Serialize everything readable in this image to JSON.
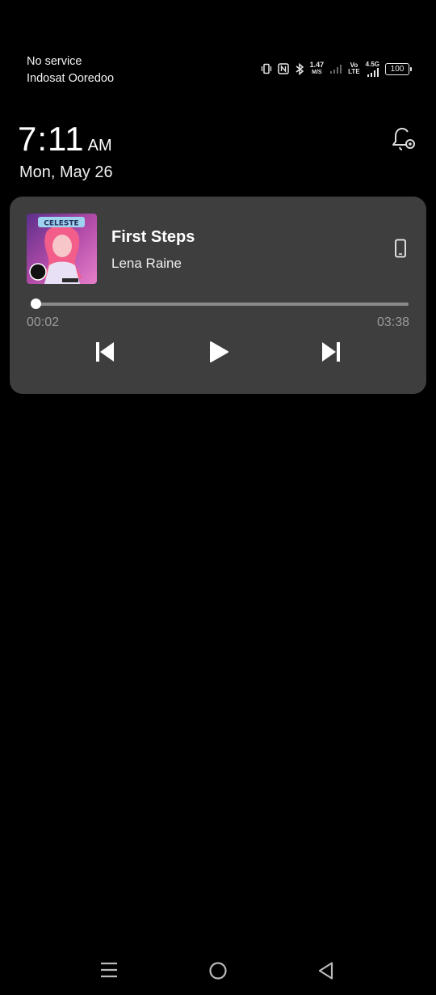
{
  "status_bar": {
    "line1": "No service",
    "line2": "Indosat Ooredoo",
    "speed_value": "1.47",
    "speed_unit": "M/S",
    "volte_top": "Vo",
    "volte_bottom": "LTE",
    "network_type": "4.5G",
    "battery_level": "100",
    "icons": [
      "vibrate-icon",
      "nfc-icon",
      "bluetooth-icon",
      "signal-weak-icon",
      "volte-icon",
      "signal-icon",
      "battery-icon"
    ]
  },
  "lockscreen": {
    "time": "7:11",
    "ampm": "AM",
    "date": "Mon, May 26"
  },
  "media": {
    "title": "First Steps",
    "artist": "Lena Raine",
    "album_art_text": "CELESTE",
    "elapsed": "00:02",
    "duration": "03:38",
    "progress_fraction": 0.009,
    "output_device": "phone-icon"
  },
  "nav_bar": {
    "items": [
      "menu-icon",
      "home-icon",
      "back-icon"
    ]
  },
  "colors": {
    "background": "#000000",
    "card": "#3e3e3e",
    "muted_text": "#9a9a9a"
  }
}
